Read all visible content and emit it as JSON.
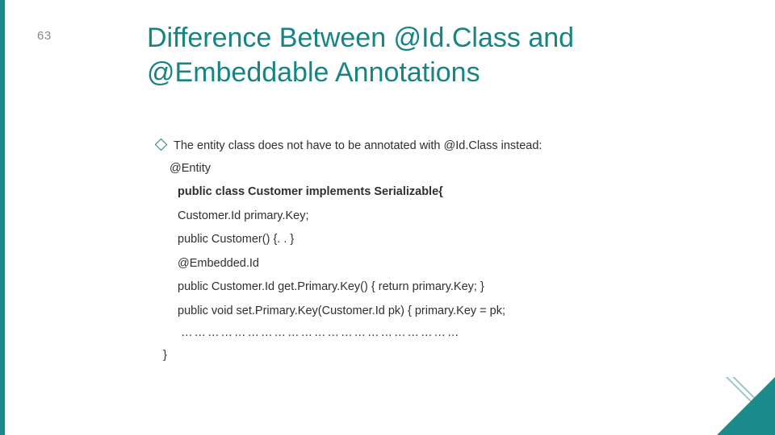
{
  "page_number": "63",
  "title": "Difference Between @Id.Class and @Embeddable Annotations",
  "bullet": "The entity class does not have to be annotated with @Id.Class instead:",
  "code": {
    "entity_annotation": "@Entity",
    "class_decl": "public class Customer implements Serializable{",
    "field": "Customer.Id primary.Key;",
    "ctor": "public Customer() {. . }",
    "embedded": "@Embedded.Id",
    "getter": "public  Customer.Id get.Primary.Key() { return primary.Key; }",
    "setter": "public void set.Primary.Key(Customer.Id pk) { primary.Key = pk;",
    "dots": "………………………………………………………",
    "close": "}"
  }
}
